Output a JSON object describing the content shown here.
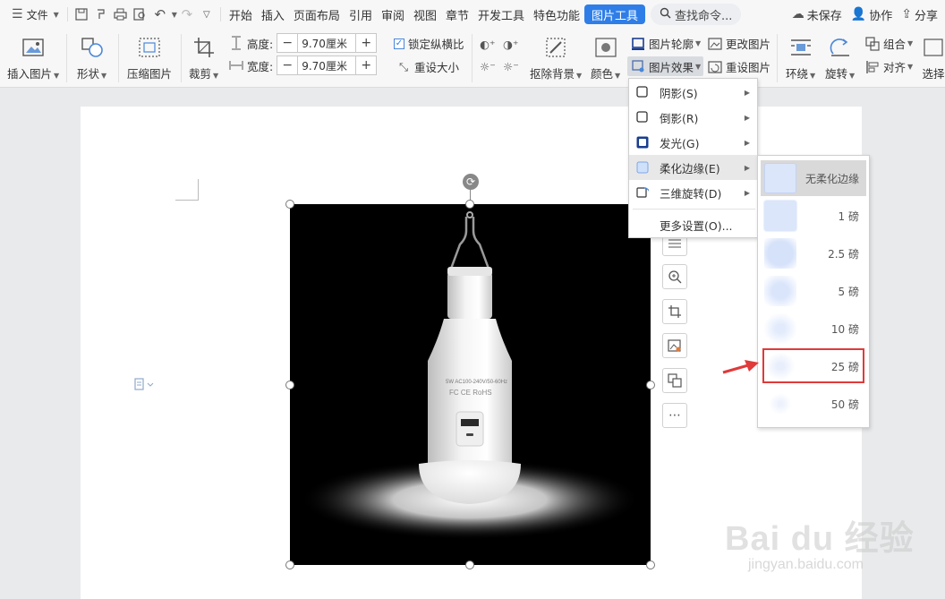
{
  "menubar": {
    "file_label": "文件",
    "tabs": [
      {
        "label": "开始"
      },
      {
        "label": "插入"
      },
      {
        "label": "页面布局"
      },
      {
        "label": "引用"
      },
      {
        "label": "审阅"
      },
      {
        "label": "视图"
      },
      {
        "label": "章节"
      },
      {
        "label": "开发工具"
      },
      {
        "label": "特色功能"
      },
      {
        "label": "图片工具"
      }
    ],
    "search_label": "查找命令...",
    "unsaved_label": "未保存",
    "collab_label": "协作",
    "share_label": "分享"
  },
  "ribbon": {
    "insert_picture": "插入图片",
    "shape": "形状",
    "compress_picture": "压缩图片",
    "crop": "裁剪",
    "height_label": "高度:",
    "height_value": "9.70厘米",
    "width_label": "宽度:",
    "width_value": "9.70厘米",
    "lock_ratio": "锁定纵横比",
    "reset_size": "重设大小",
    "remove_bg": "抠除背景",
    "color": "颜色",
    "picture_outline": "图片轮廓",
    "picture_effect": "图片效果",
    "change_picture": "更改图片",
    "reset_picture": "重设图片",
    "wrap": "环绕",
    "rotate": "旋转",
    "group": "组合",
    "align": "对齐",
    "select": "选择"
  },
  "effects_menu": {
    "items": [
      {
        "label": "阴影(S)"
      },
      {
        "label": "倒影(R)"
      },
      {
        "label": "发光(G)"
      },
      {
        "label": "柔化边缘(E)"
      },
      {
        "label": "三维旋转(D)"
      },
      {
        "label": "更多设置(O)..."
      }
    ]
  },
  "soft_edge_submenu": {
    "items": [
      {
        "label": "无柔化边缘",
        "blur": 0
      },
      {
        "label": "1 磅",
        "blur": 1
      },
      {
        "label": "2.5 磅",
        "blur": 2.5
      },
      {
        "label": "5 磅",
        "blur": 5
      },
      {
        "label": "10 磅",
        "blur": 10
      },
      {
        "label": "25 磅",
        "blur": 25
      },
      {
        "label": "50 磅",
        "blur": 50
      }
    ],
    "highlighted": "25 磅"
  },
  "photo": {
    "bulb_text_1": "5W AC100-240V/50-60Hz",
    "bulb_text_2": "FC CE RoHS"
  },
  "watermark": {
    "brand": "Bai du 经验",
    "url": "jingyan.baidu.com"
  },
  "colors": {
    "accent": "#2f7ee8",
    "highlight_red": "#e03a3a"
  }
}
